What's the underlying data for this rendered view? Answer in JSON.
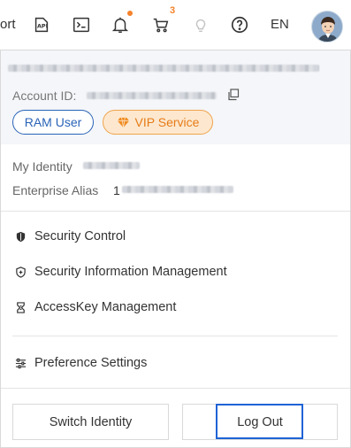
{
  "topbar": {
    "truncated_label": "ort",
    "cart_count": "3",
    "language": "EN",
    "icons": [
      "api-icon",
      "terminal-icon",
      "bell-icon",
      "cart-icon",
      "lightbulb-icon",
      "help-icon"
    ],
    "accent_color": "#f5822a"
  },
  "account": {
    "account_id_label": "Account ID:",
    "ram_badge": "RAM User",
    "vip_badge": "VIP Service"
  },
  "identity": {
    "my_identity_label": "My Identity",
    "enterprise_alias_label": "Enterprise Alias",
    "enterprise_alias_prefix": "1"
  },
  "menu": {
    "items": [
      {
        "label": "Security Control",
        "icon": "shield-check-icon"
      },
      {
        "label": "Security Information Management",
        "icon": "shield-plus-icon"
      },
      {
        "label": "AccessKey Management",
        "icon": "key-icon"
      },
      {
        "label": "Preference Settings",
        "icon": "sliders-icon"
      }
    ]
  },
  "footer": {
    "switch_identity": "Switch Identity",
    "log_out": "Log Out"
  },
  "colors": {
    "ram_blue": "#2a63b8",
    "vip_orange": "#e67b17",
    "vip_bg": "#fde8cf",
    "focus_blue": "#1f63d6"
  }
}
